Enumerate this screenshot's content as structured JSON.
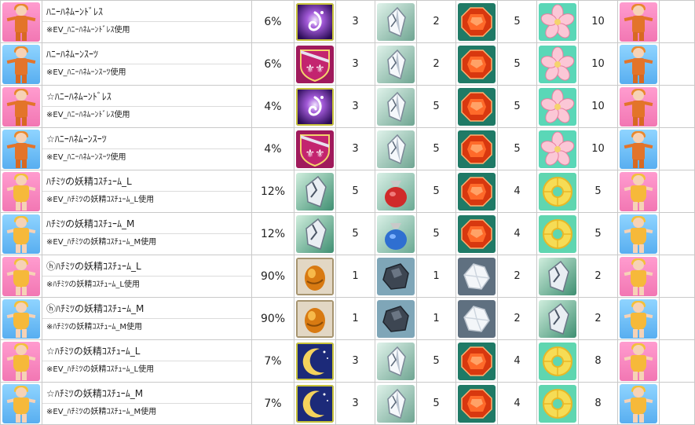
{
  "rows": [
    {
      "name": "ﾊﾆｰﾊﾈﾑｰﾝﾄﾞﾚｽ",
      "note": "※EV_ﾊﾆｰﾊﾈﾑｰﾝﾄﾞﾚｽ使用",
      "rate": "6%",
      "thumb": "pink",
      "figure": "costume",
      "items": [
        {
          "icon": "purple-swirl-icon",
          "qty": "3"
        },
        {
          "icon": "silver-crystal-icon",
          "qty": "2"
        },
        {
          "icon": "red-gem-icon",
          "qty": "5"
        },
        {
          "icon": "pink-flower-icon",
          "qty": "10"
        }
      ]
    },
    {
      "name": "ﾊﾆｰﾊﾈﾑｰﾝｽｰﾂ",
      "note": "※EV_ﾊﾆｰﾊﾈﾑｰﾝｽｰﾂ使用",
      "rate": "6%",
      "thumb": "blue",
      "figure": "costume",
      "items": [
        {
          "icon": "fleur-shield-icon",
          "qty": "3"
        },
        {
          "icon": "silver-crystal-icon",
          "qty": "2"
        },
        {
          "icon": "red-gem-icon",
          "qty": "5"
        },
        {
          "icon": "pink-flower-icon",
          "qty": "10"
        }
      ]
    },
    {
      "name": "☆ﾊﾆｰﾊﾈﾑｰﾝﾄﾞﾚｽ",
      "note": "※EV_ﾊﾆｰﾊﾈﾑｰﾝﾄﾞﾚｽ使用",
      "rate": "4%",
      "thumb": "pink",
      "figure": "costume",
      "items": [
        {
          "icon": "purple-swirl-icon",
          "qty": "3"
        },
        {
          "icon": "silver-crystal-icon",
          "qty": "5"
        },
        {
          "icon": "red-gem-icon",
          "qty": "5"
        },
        {
          "icon": "pink-flower-icon",
          "qty": "10"
        }
      ]
    },
    {
      "name": "☆ﾊﾆｰﾊﾈﾑｰﾝｽｰﾂ",
      "note": "※EV_ﾊﾆｰﾊﾈﾑｰﾝｽｰﾂ使用",
      "rate": "4%",
      "thumb": "blue",
      "figure": "costume",
      "items": [
        {
          "icon": "fleur-shield-icon",
          "qty": "3"
        },
        {
          "icon": "silver-crystal-icon",
          "qty": "5"
        },
        {
          "icon": "red-gem-icon",
          "qty": "5"
        },
        {
          "icon": "pink-flower-icon",
          "qty": "10"
        }
      ]
    },
    {
      "name": "ﾊﾁﾐﾂの妖精ｺｽﾁｭｰﾑ_L",
      "note": "※EV_ﾊﾁﾐﾂの妖精ｺｽﾁｭｰﾑ_L使用",
      "rate": "12%",
      "thumb": "pink",
      "figure": "fairy",
      "items": [
        {
          "icon": "green-crystal-icon",
          "qty": "5"
        },
        {
          "icon": "red-pouch-icon",
          "qty": "5"
        },
        {
          "icon": "red-gem-icon",
          "qty": "4"
        },
        {
          "icon": "pineapple-ring-icon",
          "qty": "5"
        }
      ]
    },
    {
      "name": "ﾊﾁﾐﾂの妖精ｺｽﾁｭｰﾑ_M",
      "note": "※EV_ﾊﾁﾐﾂの妖精ｺｽﾁｭｰﾑ_M使用",
      "rate": "12%",
      "thumb": "blue",
      "figure": "fairy",
      "items": [
        {
          "icon": "green-crystal-icon",
          "qty": "5"
        },
        {
          "icon": "blue-pouch-icon",
          "qty": "5"
        },
        {
          "icon": "red-gem-icon",
          "qty": "4"
        },
        {
          "icon": "pineapple-ring-icon",
          "qty": "5"
        }
      ]
    },
    {
      "name": "ⓗﾊﾁﾐﾂの妖精ｺｽﾁｭｰﾑ_L",
      "note": "※ﾊﾁﾐﾂの妖精ｺｽﾁｭｰﾑ_L使用",
      "rate": "90%",
      "thumb": "pink",
      "figure": "fairy",
      "items": [
        {
          "icon": "orange-bean-icon",
          "qty": "1"
        },
        {
          "icon": "dark-ore-icon",
          "qty": "1"
        },
        {
          "icon": "white-crystal-icon",
          "qty": "2"
        },
        {
          "icon": "green-crystal-icon",
          "qty": "2"
        }
      ]
    },
    {
      "name": "ⓗﾊﾁﾐﾂの妖精ｺｽﾁｭｰﾑ_M",
      "note": "※ﾊﾁﾐﾂの妖精ｺｽﾁｭｰﾑ_M使用",
      "rate": "90%",
      "thumb": "blue",
      "figure": "fairy",
      "items": [
        {
          "icon": "orange-bean-icon",
          "qty": "1"
        },
        {
          "icon": "dark-ore-icon",
          "qty": "1"
        },
        {
          "icon": "white-crystal-icon",
          "qty": "2"
        },
        {
          "icon": "green-crystal-icon",
          "qty": "2"
        }
      ]
    },
    {
      "name": "☆ﾊﾁﾐﾂの妖精ｺｽﾁｭｰﾑ_L",
      "note": "※EV_ﾊﾁﾐﾂの妖精ｺｽﾁｭｰﾑ_L使用",
      "rate": "7%",
      "thumb": "pink",
      "figure": "fairy",
      "items": [
        {
          "icon": "crescent-moon-icon",
          "qty": "3"
        },
        {
          "icon": "silver-crystal-icon",
          "qty": "5"
        },
        {
          "icon": "red-gem-icon",
          "qty": "4"
        },
        {
          "icon": "pineapple-ring-icon",
          "qty": "8"
        }
      ]
    },
    {
      "name": "☆ﾊﾁﾐﾂの妖精ｺｽﾁｭｰﾑ_M",
      "note": "※EV_ﾊﾁﾐﾂの妖精ｺｽﾁｭｰﾑ_M使用",
      "rate": "7%",
      "thumb": "blue",
      "figure": "fairy",
      "items": [
        {
          "icon": "crescent-moon-icon",
          "qty": "3"
        },
        {
          "icon": "silver-crystal-icon",
          "qty": "5"
        },
        {
          "icon": "red-gem-icon",
          "qty": "4"
        },
        {
          "icon": "pineapple-ring-icon",
          "qty": "8"
        }
      ]
    }
  ]
}
